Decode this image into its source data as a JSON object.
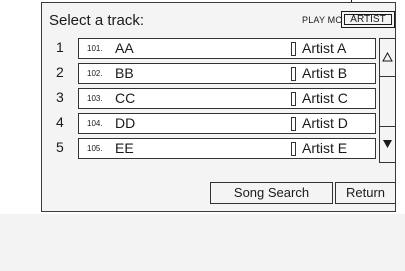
{
  "screen": {
    "title": "Select a track:",
    "play_mode_label": "PLAY MOD",
    "artist_mode_label": "ARTIST"
  },
  "tracks": [
    {
      "index": "1",
      "number": "101.",
      "name": "AA",
      "artist": "Artist A"
    },
    {
      "index": "2",
      "number": "102.",
      "name": "BB",
      "artist": "Artist B"
    },
    {
      "index": "3",
      "number": "103.",
      "name": "CC",
      "artist": "Artist C"
    },
    {
      "index": "4",
      "number": "104.",
      "name": "DD",
      "artist": "Artist D"
    },
    {
      "index": "5",
      "number": "105.",
      "name": "EE",
      "artist": "Artist E"
    }
  ],
  "buttons": {
    "song_search": "Song Search",
    "return": "Return"
  },
  "icons": {
    "scroll_up": "triangle-up-outline-icon",
    "scroll_down": "triangle-down-filled-icon",
    "callout": "callout-arrow-icon"
  }
}
